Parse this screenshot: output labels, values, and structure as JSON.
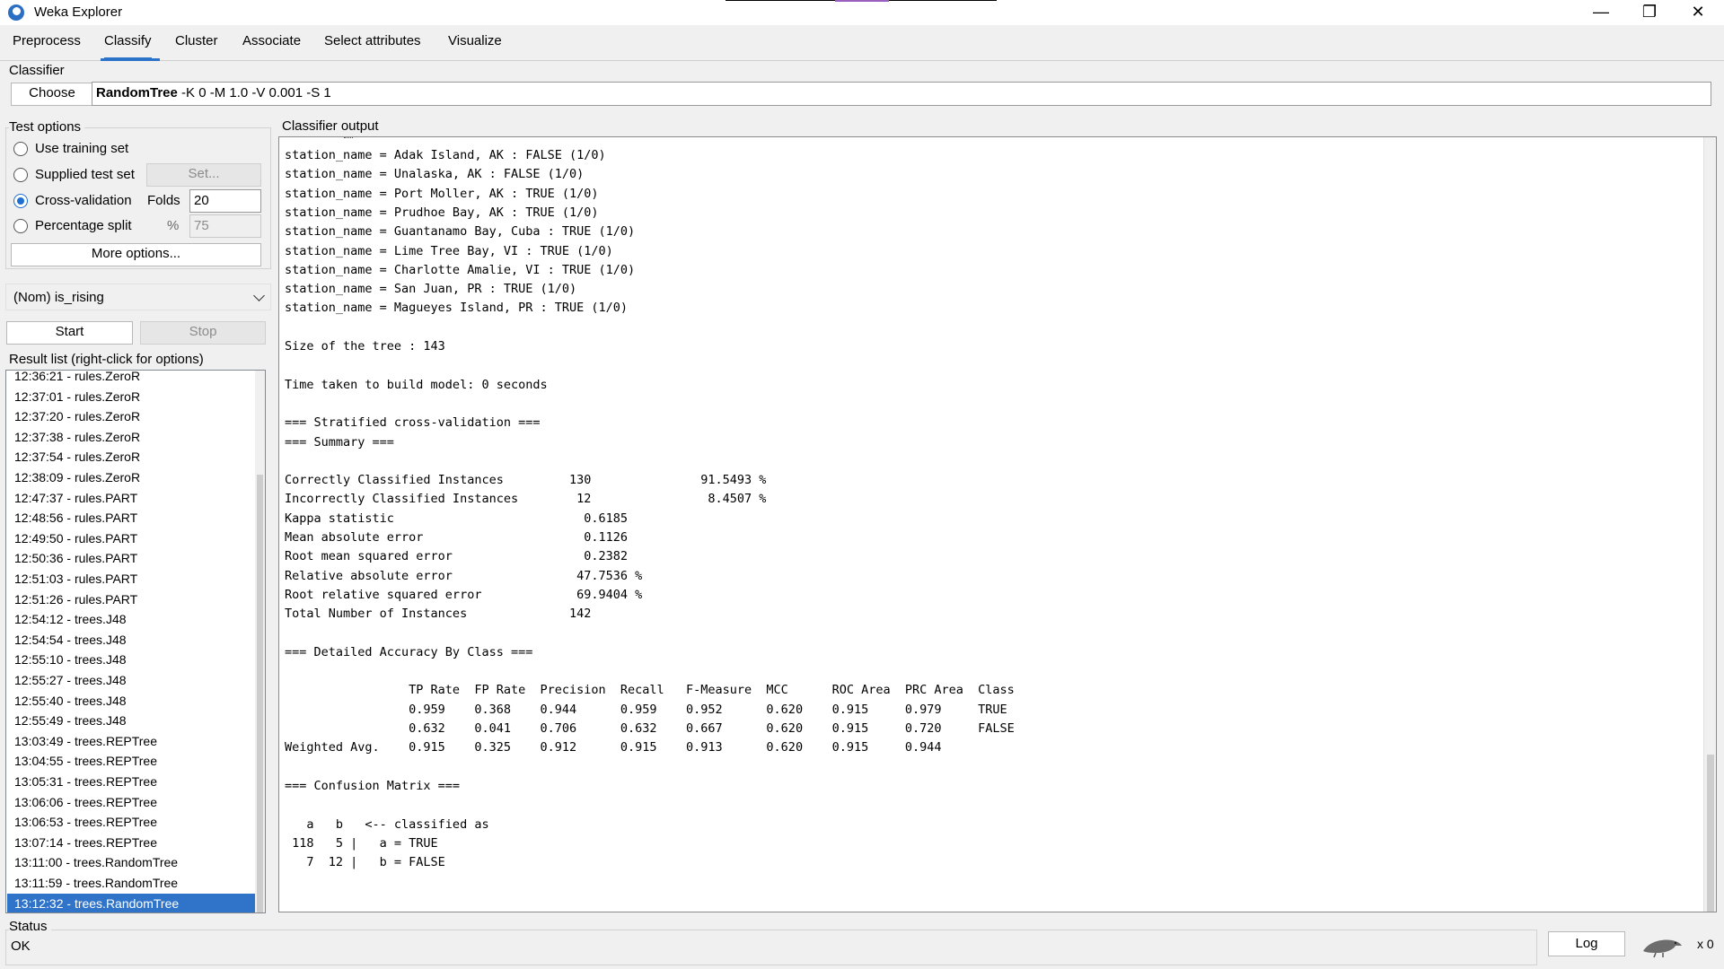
{
  "window": {
    "title": "Weka Explorer",
    "minimize": "—",
    "restore": "❐",
    "close": "✕"
  },
  "tabs": [
    "Preprocess",
    "Classify",
    "Cluster",
    "Associate",
    "Select attributes",
    "Visualize"
  ],
  "active_tab": "Classify",
  "classifier": {
    "group_label": "Classifier",
    "choose_label": "Choose",
    "name": "RandomTree",
    "options": " -K 0 -M 1.0 -V 0.001 -S 1"
  },
  "test_options": {
    "group_label": "Test options",
    "use_training": "Use training set",
    "supplied_test": "Supplied test set",
    "set_label": "Set...",
    "cross_validation": "Cross-validation",
    "folds_label": "Folds",
    "folds_value": "20",
    "percentage_split": "Percentage split",
    "percent_symbol": "%",
    "percent_value": "75",
    "selected": "Cross-validation",
    "more_options": "More options..."
  },
  "class_attribute": "(Nom) is_rising",
  "start_label": "Start",
  "stop_label": "Stop",
  "result_list": {
    "label": "Result list (right-click for options)",
    "items": [
      "12:36:21 - rules.ZeroR",
      "12:37:01 - rules.ZeroR",
      "12:37:20 - rules.ZeroR",
      "12:37:38 - rules.ZeroR",
      "12:37:54 - rules.ZeroR",
      "12:38:09 - rules.ZeroR",
      "12:47:37 - rules.PART",
      "12:48:56 - rules.PART",
      "12:49:50 - rules.PART",
      "12:50:36 - rules.PART",
      "12:51:03 - rules.PART",
      "12:51:26 - rules.PART",
      "12:54:12 - trees.J48",
      "12:54:54 - trees.J48",
      "12:55:10 - trees.J48",
      "12:55:27 - trees.J48",
      "12:55:40 - trees.J48",
      "12:55:49 - trees.J48",
      "13:03:49 - trees.REPTree",
      "13:04:55 - trees.REPTree",
      "13:05:31 - trees.REPTree",
      "13:06:06 - trees.REPTree",
      "13:06:53 - trees.REPTree",
      "13:07:14 - trees.REPTree",
      "13:11:00 - trees.RandomTree",
      "13:11:59 - trees.RandomTree",
      "13:12:32 - trees.RandomTree"
    ],
    "selected": "13:12:32 - trees.RandomTree"
  },
  "output": {
    "label": "Classifier output",
    "lines": [
      "station_name = Adak Island, AK : FALSE (1/0)",
      "station_name = Unalaska, AK : FALSE (1/0)",
      "station_name = Port Moller, AK : TRUE (1/0)",
      "station_name = Prudhoe Bay, AK : TRUE (1/0)",
      "station_name = Guantanamo Bay, Cuba : TRUE (1/0)",
      "station_name = Lime Tree Bay, VI : TRUE (1/0)",
      "station_name = Charlotte Amalie, VI : TRUE (1/0)",
      "station_name = San Juan, PR : TRUE (1/0)",
      "station_name = Magueyes Island, PR : TRUE (1/0)",
      "",
      "Size of the tree : 143",
      "",
      "Time taken to build model: 0 seconds",
      "",
      "=== Stratified cross-validation ===",
      "=== Summary ===",
      "",
      "Correctly Classified Instances         130               91.5493 %",
      "Incorrectly Classified Instances        12                8.4507 %",
      "Kappa statistic                          0.6185",
      "Mean absolute error                      0.1126",
      "Root mean squared error                  0.2382",
      "Relative absolute error                 47.7536 %",
      "Root relative squared error             69.9404 %",
      "Total Number of Instances              142",
      "",
      "=== Detailed Accuracy By Class ===",
      "",
      "                 TP Rate  FP Rate  Precision  Recall   F-Measure  MCC      ROC Area  PRC Area  Class",
      "                 0.959    0.368    0.944      0.959    0.952      0.620    0.915     0.979     TRUE",
      "                 0.632    0.041    0.706      0.632    0.667      0.620    0.915     0.720     FALSE",
      "Weighted Avg.    0.915    0.325    0.912      0.915    0.913      0.620    0.915     0.944",
      "",
      "=== Confusion Matrix ===",
      "",
      "   a   b   <-- classified as",
      " 118   5 |   a = TRUE",
      "   7  12 |   b = FALSE"
    ]
  },
  "status": {
    "label": "Status",
    "text": "OK",
    "log_label": "Log",
    "count": "x 0"
  }
}
